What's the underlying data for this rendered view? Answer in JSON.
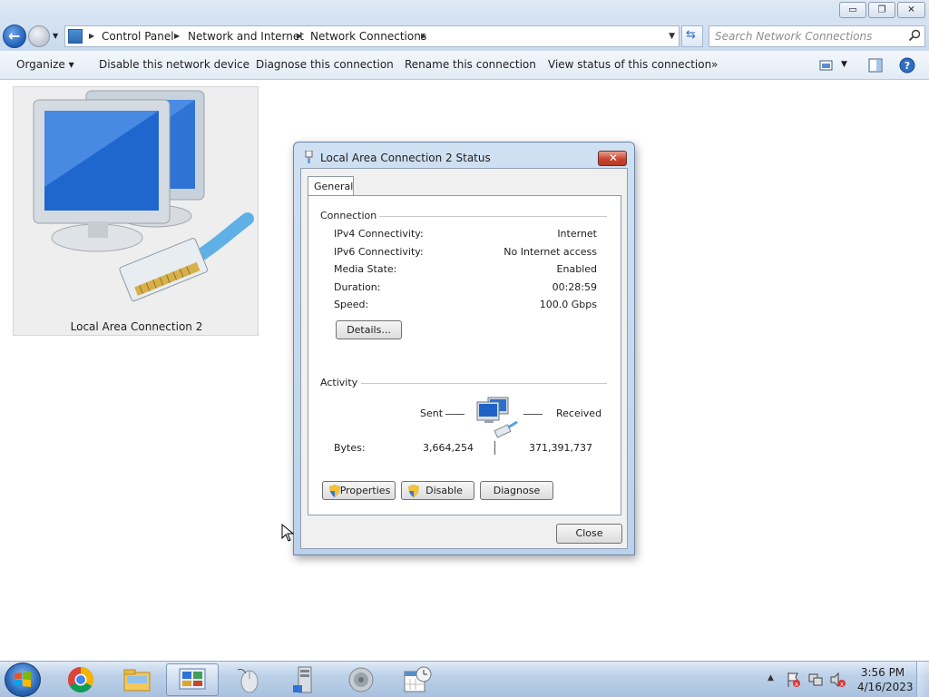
{
  "window": {
    "controls": {
      "minimize": "▭",
      "maximize": "❐",
      "close": "✕"
    }
  },
  "address": {
    "breadcrumbs": [
      "Control Panel",
      "Network and Internet",
      "Network Connections"
    ],
    "search_placeholder": "Search Network Connections"
  },
  "toolbar": {
    "organize": "Organize ▾",
    "disable": "Disable this network device",
    "diagnose": "Diagnose this connection",
    "rename": "Rename this connection",
    "view_status": "View status of this connection",
    "more": "»"
  },
  "connection_tile": {
    "label": "Local Area Connection 2",
    "icon": "network-computers-icon"
  },
  "dialog": {
    "title": "Local Area Connection 2 Status",
    "close_glyph": "✕",
    "tab": "General",
    "connection_group": "Connection",
    "rows": [
      {
        "label": "IPv4 Connectivity:",
        "value": "Internet"
      },
      {
        "label": "IPv6 Connectivity:",
        "value": "No Internet access"
      },
      {
        "label": "Media State:",
        "value": "Enabled"
      },
      {
        "label": "Duration:",
        "value": "00:28:59"
      },
      {
        "label": "Speed:",
        "value": "100.0 Gbps"
      }
    ],
    "details_button": "Details...",
    "activity_group": "Activity",
    "sent_label": "Sent",
    "received_label": "Received",
    "bytes_label": "Bytes:",
    "bytes_sent": "3,664,254",
    "bytes_received": "371,391,737",
    "properties_button": "Properties",
    "disable_button": "Disable",
    "diagnose_button": "Diagnose",
    "close_button": "Close"
  },
  "taskbar": {
    "pinned": [
      "chrome-icon",
      "file-explorer-icon",
      "control-panel-icon",
      "mouse-icon",
      "server-icon",
      "speaker-icon",
      "calendar-clock-icon"
    ],
    "active": "control-panel-icon"
  },
  "tray": {
    "time": "3:56 PM",
    "date": "4/16/2023"
  },
  "colors": {
    "accent": "#2f6ec4",
    "close_red": "#c8452e",
    "tile_bg": "#eeeeef"
  }
}
